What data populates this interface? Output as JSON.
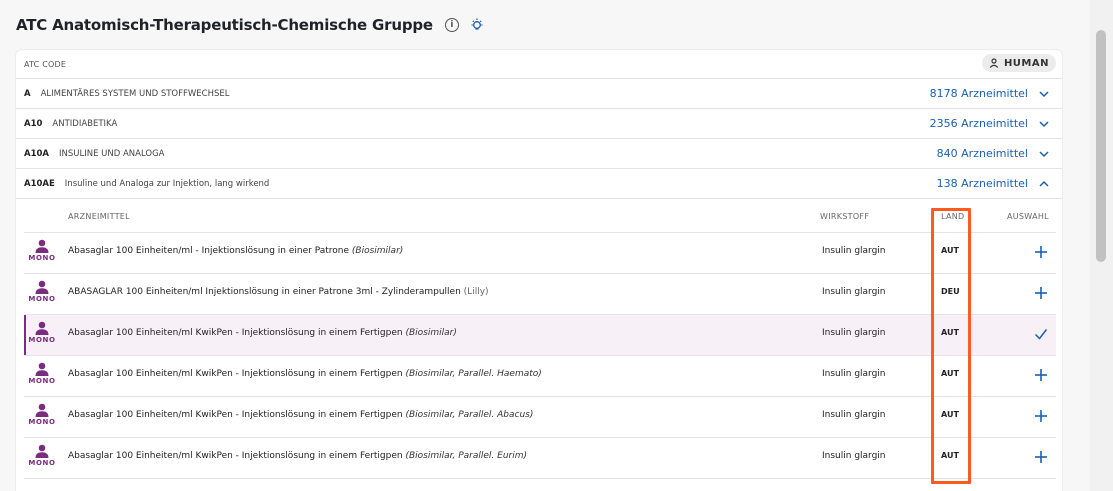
{
  "header": {
    "title": "ATC Anatomisch-Therapeutisch-Chemische Gruppe"
  },
  "atc_header": {
    "label": "ATC CODE",
    "badge": "HUMAN"
  },
  "atc_rows": [
    {
      "code": "A",
      "name": "ALIMENTÄRES SYSTEM UND STOFFWECHSEL",
      "count": "8178 Arzneimittel",
      "expanded": false
    },
    {
      "code": "A10",
      "name": "ANTIDIABETIKA",
      "count": "2356 Arzneimittel",
      "expanded": false
    },
    {
      "code": "A10A",
      "name": "INSULINE UND ANALOGA",
      "count": "840 Arzneimittel",
      "expanded": false
    },
    {
      "code": "A10AE",
      "name": "Insuline und Analoga zur Injektion, lang wirkend",
      "count": "138 Arzneimittel",
      "expanded": true
    }
  ],
  "columns": {
    "arzneimittel": "ARZNEIMITTEL",
    "wirkstoff": "WIRKSTOFF",
    "land": "LAND",
    "auswahl": "AUSWAHL"
  },
  "mono_label": "MONO",
  "drugs": [
    {
      "name": "Abasaglar 100 Einheiten/ml - Injektionslösung in einer Patrone",
      "suffix": "(Biosimilar)",
      "suffix_italic": true,
      "wirkstoff": "Insulin glargin",
      "land": "AUT",
      "selected": false
    },
    {
      "name": "ABASAGLAR 100 Einheiten/ml Injektionslösung in einer Patrone 3ml - Zylinderampullen",
      "suffix": "(Lilly)",
      "suffix_italic": false,
      "wirkstoff": "Insulin glargin",
      "land": "DEU",
      "selected": false
    },
    {
      "name": "Abasaglar 100 Einheiten/ml KwikPen - Injektionslösung in einem Fertigpen",
      "suffix": "(Biosimilar)",
      "suffix_italic": true,
      "wirkstoff": "Insulin glargin",
      "land": "AUT",
      "selected": true
    },
    {
      "name": "Abasaglar 100 Einheiten/ml KwikPen - Injektionslösung in einem Fertigpen",
      "suffix": "(Biosimilar, Parallel. Haemato)",
      "suffix_italic": true,
      "wirkstoff": "Insulin glargin",
      "land": "AUT",
      "selected": false
    },
    {
      "name": "Abasaglar 100 Einheiten/ml KwikPen - Injektionslösung in einem Fertigpen",
      "suffix": "(Biosimilar, Parallel. Abacus)",
      "suffix_italic": true,
      "wirkstoff": "Insulin glargin",
      "land": "AUT",
      "selected": false
    },
    {
      "name": "Abasaglar 100 Einheiten/ml KwikPen - Injektionslösung in einem Fertigpen",
      "suffix": "(Biosimilar, Parallel. Eurim)",
      "suffix_italic": true,
      "wirkstoff": "Insulin glargin",
      "land": "AUT",
      "selected": false
    }
  ],
  "colors": {
    "accent_blue": "#1a5fb4",
    "mono_purple": "#7a2d7f",
    "highlight_orange": "#ff5a1f"
  }
}
